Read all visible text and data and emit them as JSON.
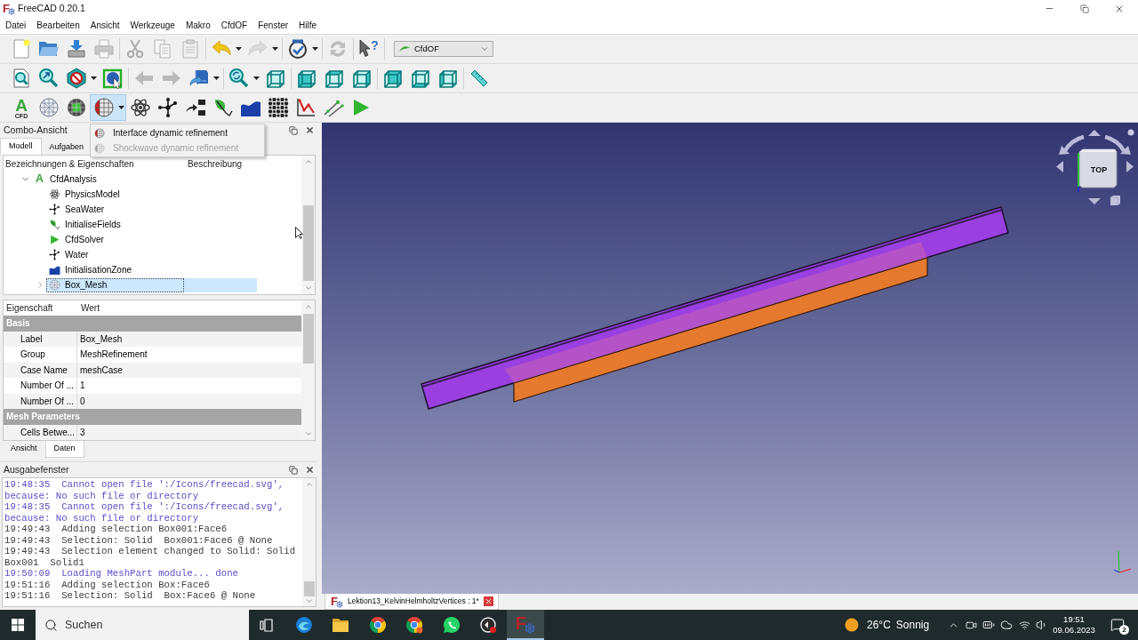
{
  "window": {
    "title": "FreeCAD 0.20.1",
    "logo_letter": "F"
  },
  "menu": [
    "Datei",
    "Bearbeiten",
    "Ansicht",
    "Werkzeuge",
    "Makro",
    "CfdOF",
    "Fenster",
    "Hilfe"
  ],
  "toolbars": [
    [
      {
        "kind": "new",
        "disabled": false,
        "dropdown": false
      },
      {
        "kind": "open",
        "disabled": false,
        "dropdown": false
      },
      {
        "kind": "save",
        "disabled": false,
        "dropdown": false
      },
      {
        "kind": "print",
        "disabled": true,
        "dropdown": false
      },
      {
        "kind": "separator"
      },
      {
        "kind": "cut",
        "disabled": true,
        "dropdown": false
      },
      {
        "kind": "copy",
        "disabled": true,
        "dropdown": false
      },
      {
        "kind": "paste",
        "disabled": true,
        "dropdown": false
      },
      {
        "kind": "separator"
      },
      {
        "kind": "undo",
        "disabled": false,
        "dropdown": true
      },
      {
        "kind": "redo",
        "disabled": true,
        "dropdown": true
      },
      {
        "kind": "separator"
      },
      {
        "kind": "check",
        "disabled": false,
        "dropdown": true
      },
      {
        "kind": "separator"
      },
      {
        "kind": "refresh",
        "disabled": true,
        "dropdown": false
      },
      {
        "kind": "separator"
      },
      {
        "kind": "whats-this",
        "disabled": false,
        "dropdown": false,
        "glyph": "?"
      },
      {
        "kind": "separator"
      }
    ],
    [
      {
        "kind": "fit-all",
        "disabled": false,
        "dropdown": false
      },
      {
        "kind": "fit-selection",
        "disabled": false,
        "dropdown": false
      },
      {
        "kind": "draw-style",
        "disabled": false,
        "dropdown": true
      },
      {
        "kind": "bounding-box",
        "disabled": false,
        "dropdown": false
      },
      {
        "kind": "separator"
      },
      {
        "kind": "back",
        "disabled": true,
        "dropdown": false
      },
      {
        "kind": "forward",
        "disabled": true,
        "dropdown": false
      },
      {
        "kind": "view-menu",
        "disabled": false,
        "dropdown": true
      },
      {
        "kind": "separator"
      },
      {
        "kind": "zoom",
        "disabled": false,
        "dropdown": true
      },
      {
        "kind": "view-iso",
        "disabled": false,
        "dropdown": false
      },
      {
        "kind": "separator"
      },
      {
        "kind": "view-front",
        "disabled": false,
        "dropdown": false
      },
      {
        "kind": "view-top",
        "disabled": false,
        "dropdown": false
      },
      {
        "kind": "view-right",
        "disabled": false,
        "dropdown": false
      },
      {
        "kind": "separator"
      },
      {
        "kind": "view-rear",
        "disabled": false,
        "dropdown": false
      },
      {
        "kind": "view-bottom",
        "disabled": false,
        "dropdown": false
      },
      {
        "kind": "view-left",
        "disabled": false,
        "dropdown": false
      },
      {
        "kind": "separator"
      },
      {
        "kind": "measure",
        "disabled": false,
        "dropdown": false
      }
    ],
    [
      {
        "kind": "analysis",
        "dropdown": false,
        "open": false,
        "text": "A",
        "caption": "CFD"
      },
      {
        "kind": "mesh",
        "dropdown": false,
        "open": false
      },
      {
        "kind": "mesh-fine",
        "dropdown": false,
        "open": false
      },
      {
        "kind": "refinement",
        "dropdown": true,
        "open": true
      },
      {
        "kind": "physics",
        "dropdown": false,
        "open": false
      },
      {
        "kind": "fluid",
        "dropdown": false,
        "open": false
      },
      {
        "kind": "initial",
        "dropdown": false,
        "open": false
      },
      {
        "kind": "initialise",
        "dropdown": false,
        "open": false
      },
      {
        "kind": "zone",
        "dropdown": false,
        "open": false
      },
      {
        "kind": "porous",
        "dropdown": false,
        "open": false
      },
      {
        "kind": "report",
        "dropdown": false,
        "open": false
      },
      {
        "kind": "probes",
        "dropdown": false,
        "open": false
      },
      {
        "kind": "solver",
        "dropdown": false,
        "open": false
      }
    ]
  ],
  "workbench": {
    "value": "CfdOF"
  },
  "combo": {
    "title": "Combo-Ansicht",
    "tabs": [
      {
        "label": "Modell",
        "selected": true
      },
      {
        "label": "Aufgaben",
        "selected": false
      }
    ]
  },
  "refinement_menu": {
    "items": [
      {
        "label": "Interface dynamic refinement",
        "disabled": false
      },
      {
        "label": "Shockwave dynamic refinement",
        "disabled": true
      }
    ]
  },
  "tree": {
    "columns": [
      "Bezeichnungen & Eigenschaften",
      "Beschreibung"
    ],
    "items": [
      {
        "label": "CfdAnalysis",
        "kind": "analysis",
        "icon_text": "A",
        "expanded": true,
        "selected": false,
        "children": [
          {
            "label": "PhysicsModel",
            "kind": "physics",
            "selected": false
          },
          {
            "label": "SeaWater",
            "kind": "fluid",
            "selected": false
          },
          {
            "label": "InitialiseFields",
            "kind": "initialise",
            "selected": false
          },
          {
            "label": "CfdSolver",
            "kind": "solver",
            "selected": false
          },
          {
            "label": "Water",
            "kind": "fluid",
            "selected": false
          },
          {
            "label": "InitialisationZone",
            "kind": "zone",
            "selected": false
          },
          {
            "label": "Box_Mesh",
            "kind": "mesh",
            "expanded": false,
            "selected": true
          }
        ]
      }
    ]
  },
  "properties": {
    "columns": [
      "Eigenschaft",
      "Wert"
    ],
    "groups": [
      {
        "name": "Basis",
        "rows": [
          {
            "property": "Label",
            "value": "Box_Mesh"
          },
          {
            "property": "Group",
            "value": "MeshRefinement"
          },
          {
            "property": "Case Name",
            "value": "meshCase"
          },
          {
            "property": "Number Of ...",
            "value": "1"
          },
          {
            "property": "Number Of ...",
            "value": "0"
          }
        ]
      },
      {
        "name": "Mesh Parameters",
        "rows": [
          {
            "property": "Cells Betwe...",
            "value": "3"
          }
        ]
      }
    ],
    "tabs": [
      {
        "label": "Ansicht",
        "selected": false
      },
      {
        "label": "Daten",
        "selected": true
      }
    ]
  },
  "output": {
    "title": "Ausgabefenster",
    "lines": [
      {
        "kind": "log",
        "text": "19:48:35  Cannot open file ':/Icons/freecad.svg',"
      },
      {
        "kind": "log",
        "text": "because: No such file or directory"
      },
      {
        "kind": "log",
        "text": "19:48:35  Cannot open file ':/Icons/freecad.svg',"
      },
      {
        "kind": "log",
        "text": "because: No such file or directory"
      },
      {
        "kind": "message",
        "text": "19:49:43  Adding selection Box001:Face6"
      },
      {
        "kind": "message",
        "text": "19:49:43  Selection: Solid  Box001:Face6 @ None"
      },
      {
        "kind": "message",
        "text": "19:49:43  Selection element changed to Solid: Solid"
      },
      {
        "kind": "message",
        "text": "Box001  Solid1"
      },
      {
        "kind": "log",
        "text": "19:50:09  Loading MeshPart module... done"
      },
      {
        "kind": "message",
        "text": "19:51:16  Adding selection Box:Face6"
      },
      {
        "kind": "message",
        "text": "19:51:16  Selection: Solid  Box:Face6 @ None"
      }
    ]
  },
  "view3d": {
    "nav_cube": {
      "face": "TOP"
    }
  },
  "document_tab": {
    "label": "Lektion13_KelvinHelmholtzVertices : 1*",
    "logo_letter": "F"
  },
  "taskbar": {
    "search": {
      "placeholder": "Suchen"
    },
    "apps": [
      {
        "kind": "task-view",
        "active": false
      },
      {
        "kind": "mail",
        "active": false
      },
      {
        "kind": "folder",
        "active": false
      },
      {
        "kind": "browser",
        "active": false
      },
      {
        "kind": "browser-alt",
        "active": false
      },
      {
        "kind": "chat",
        "active": false
      },
      {
        "kind": "recorder",
        "active": false
      },
      {
        "kind": "cad",
        "active": true,
        "logo_letter": "F"
      }
    ],
    "weather": {
      "temperature": "26°C",
      "condition": "Sonnig"
    },
    "clock": {
      "time": "19:51",
      "date": "09.06.2023"
    },
    "notifications": {
      "count": "2"
    }
  }
}
